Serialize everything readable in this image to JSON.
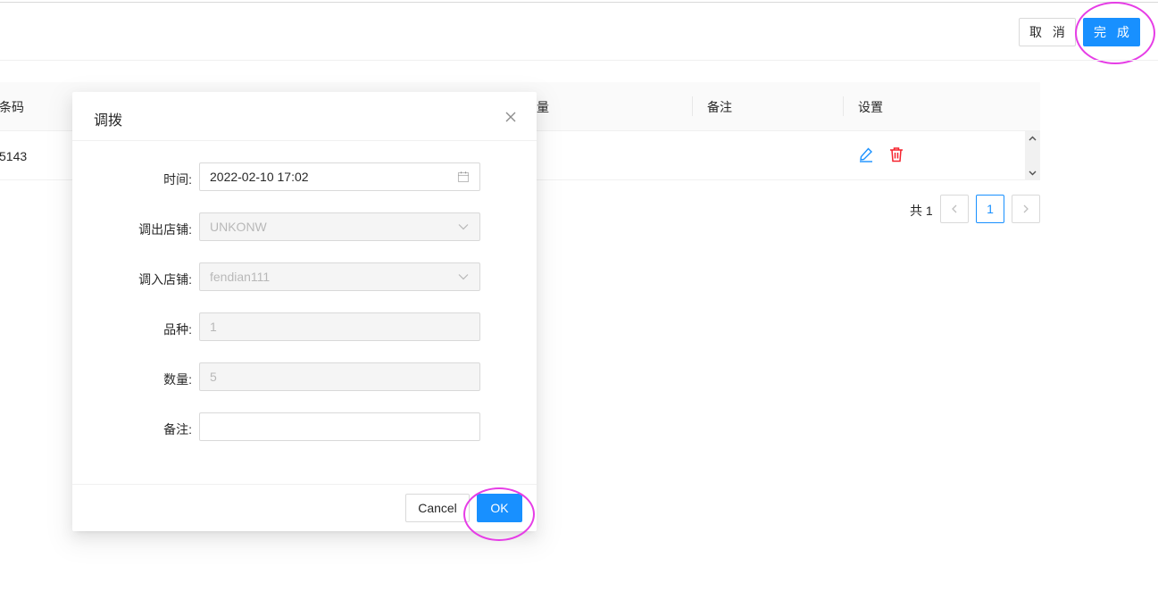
{
  "header": {
    "cancel_label": "取 消",
    "done_label": "完 成"
  },
  "table": {
    "columns": {
      "barcode": "条码",
      "quantity": "量",
      "remark": "备注",
      "settings": "设置"
    },
    "rows": [
      {
        "barcode": "5143",
        "remark": ""
      }
    ],
    "icons": {
      "edit": "edit-icon",
      "delete": "delete-icon"
    }
  },
  "pagination": {
    "total_text": "共 1",
    "current_page": "1"
  },
  "modal": {
    "title": "调拨",
    "fields": {
      "time": {
        "label": "时间:",
        "value": "2022-02-10 17:02"
      },
      "out_store": {
        "label": "调出店铺:",
        "value": "UNKONW"
      },
      "in_store": {
        "label": "调入店铺:",
        "value": "fendian111"
      },
      "variety": {
        "label": "品种:",
        "value": "1"
      },
      "quantity": {
        "label": "数量:",
        "value": "5"
      },
      "remark": {
        "label": "备注:",
        "value": ""
      }
    },
    "cancel_label": "Cancel",
    "ok_label": "OK"
  },
  "colors": {
    "primary": "#1890ff",
    "danger": "#f5222d",
    "highlight": "#e63de6"
  }
}
